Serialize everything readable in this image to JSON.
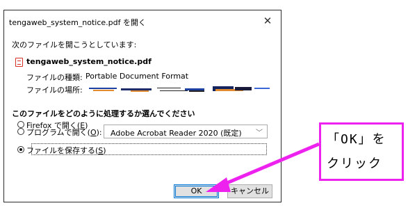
{
  "dialog": {
    "title": "tengaweb_system_notice.pdf を開く",
    "close_icon": "close-icon",
    "intro": "次のファイルを開こうとしています:",
    "file_icon": "pdf-icon",
    "filename": "tengaweb_system_notice.pdf",
    "type_label": "ファイルの種類:",
    "type_value": "Portable Document Format",
    "location_label": "ファイルの場所:",
    "question": "このファイルをどのように処理するか選んでください",
    "options": [
      {
        "label": "Firefox で開く(",
        "key": "E",
        "suffix": ")",
        "checked": false
      },
      {
        "label": "プログラムで開く(",
        "key": "O",
        "suffix": "):",
        "checked": false
      },
      {
        "label": "ファイルを保存する(",
        "key": "S",
        "suffix": ")",
        "checked": true
      }
    ],
    "program_select": {
      "value": "Adobe Acrobat Reader 2020 (既定)",
      "arrow_icon": "chevron-down-icon"
    },
    "ok_label": "OK",
    "cancel_label": "キャンセル"
  },
  "callout": {
    "line1": "「OK」を",
    "line2": "クリック",
    "border_color": "#ee22ee",
    "arrow_color": "#ee22ee"
  }
}
